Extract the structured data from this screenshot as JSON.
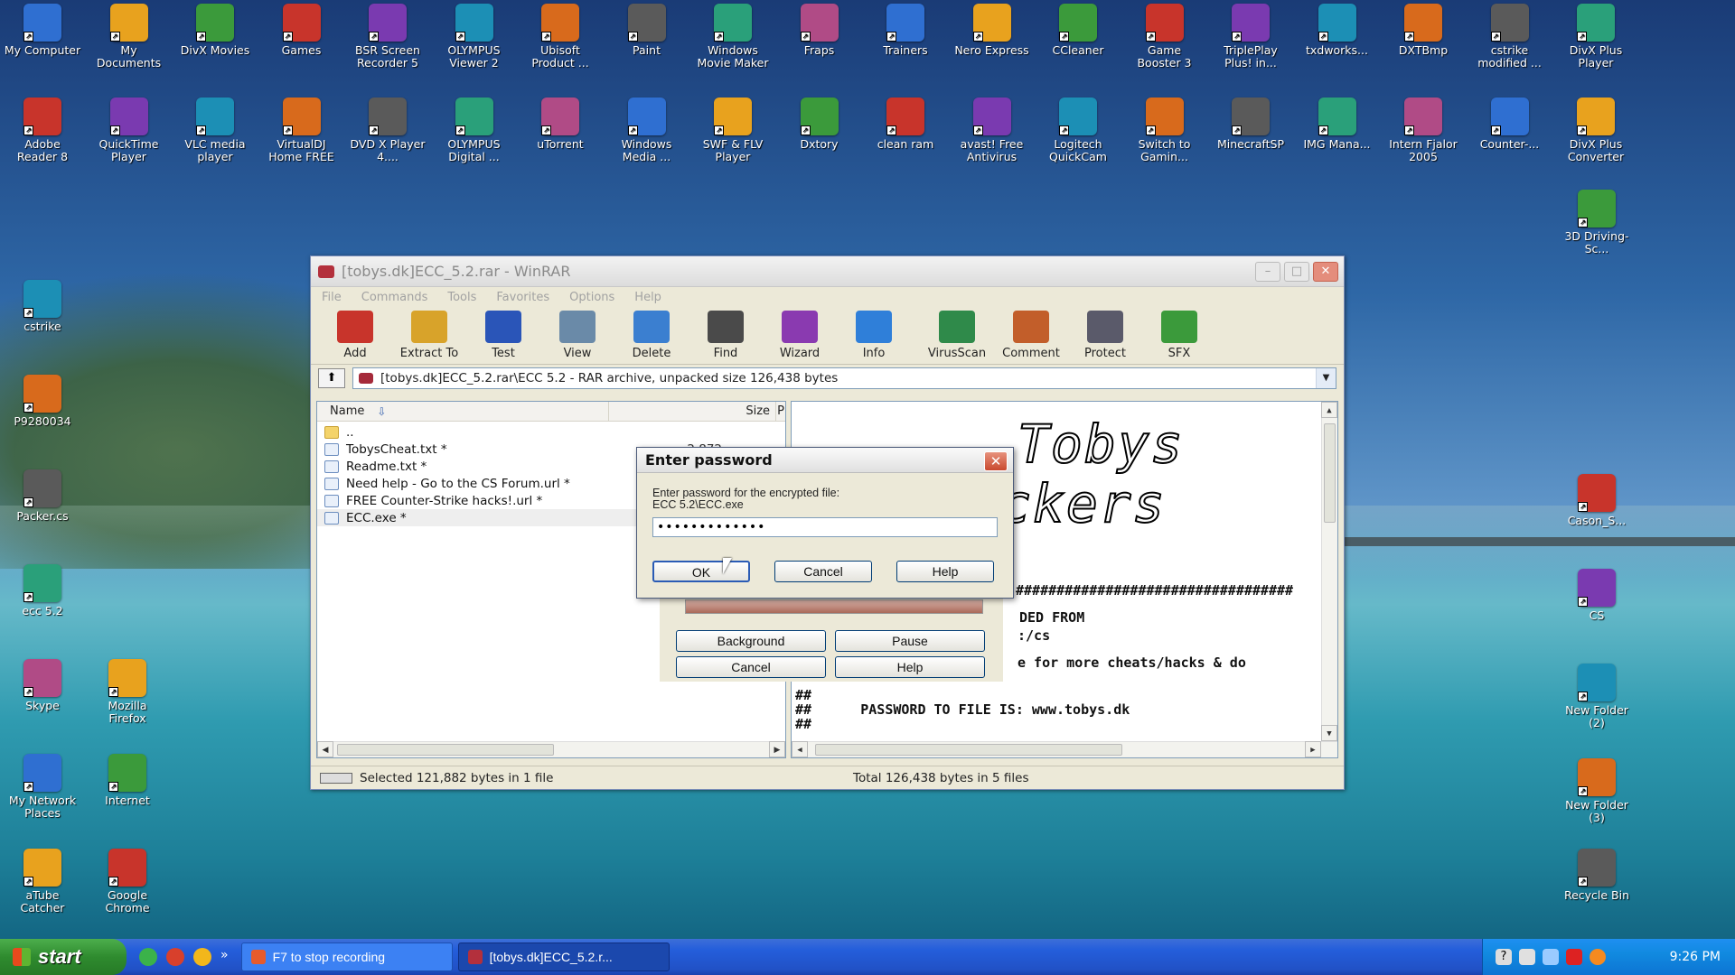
{
  "desktop": {
    "row1": [
      "My Computer",
      "My Documents",
      "DivX Movies",
      "Games",
      "BSR Screen Recorder 5",
      "OLYMPUS Viewer 2",
      "Ubisoft Product ...",
      "Paint",
      "Windows Movie Maker",
      "Fraps",
      "Trainers",
      "Nero Express",
      "CCleaner",
      "Game Booster 3",
      "TriplePlay Plus! in...",
      "txdworks...",
      "DXTBmp",
      "cstrike modified ...",
      "DivX Plus Player"
    ],
    "row2": [
      "Adobe Reader 8",
      "QuickTime Player",
      "VLC media player",
      "VirtualDJ Home FREE",
      "DVD X Player 4....",
      "OLYMPUS Digital ...",
      "uTorrent",
      "Windows Media ...",
      "SWF & FLV Player",
      "Dxtory",
      "clean ram",
      "avast! Free Antivirus",
      "Logitech QuickCam",
      "Switch to Gamin...",
      "MinecraftSP",
      "IMG Mana...",
      "Intern Fjalor 2005",
      "Counter-...",
      "DivX Plus Converter"
    ],
    "left_col": [
      "cstrike",
      "P9280034",
      "Packer.cs",
      "ecc 5.2",
      "Skype",
      "My Network Places",
      "aTube Catcher"
    ],
    "second_col": [
      "Mozilla Firefox",
      "Internet",
      "Google Chrome"
    ],
    "right_col": [
      "3D Driving-Sc...",
      "Cason_S...",
      "CS",
      "New Folder (2)",
      "New Folder (3)",
      "Recycle Bin"
    ]
  },
  "winrar": {
    "title": "[tobys.dk]ECC_5.2.rar - WinRAR",
    "menu": [
      "File",
      "Commands",
      "Tools",
      "Favorites",
      "Options",
      "Help"
    ],
    "toolbar": [
      "Add",
      "Extract To",
      "Test",
      "View",
      "Delete",
      "Find",
      "Wizard",
      "Info",
      "VirusScan",
      "Comment",
      "Protect",
      "SFX"
    ],
    "address": "[tobys.dk]ECC_5.2.rar\\ECC 5.2 - RAR archive, unpacked size 126,438 bytes",
    "columns": {
      "name": "Name",
      "size": "Size"
    },
    "files": [
      {
        "name": "..",
        "size": ""
      },
      {
        "name": "TobysCheat.txt *",
        "size": "2,872"
      },
      {
        "name": "Readme.txt *",
        "size": ""
      },
      {
        "name": "Need help - Go to the CS Forum.url *",
        "size": ""
      },
      {
        "name": "FREE Counter-Strike hacks!.url *",
        "size": ""
      },
      {
        "name": "ECC.exe *",
        "size": ""
      }
    ],
    "preview": {
      "art_line1": "Tobys",
      "art_line2": "ckers",
      "hash_line": "##################################",
      "line_downloaded": "DED FROM",
      "line_cs": ":/cs",
      "line_cheats": "e for more cheats/hacks & do",
      "line_hash1": "##",
      "line_password": "##      PASSWORD TO FILE IS: www.tobys.dk",
      "line_hash2": "##"
    },
    "status_left": "Selected 121,882 bytes in 1 file",
    "status_right": "Total 126,438 bytes in 5 files"
  },
  "progress_dialog": {
    "progress": 1.0,
    "buttons": [
      "Background",
      "Pause",
      "Cancel",
      "Help"
    ]
  },
  "password_dialog": {
    "title": "Enter password",
    "label_line1": "Enter password for the encrypted file:",
    "label_line2": "ECC 5.2\\ECC.exe",
    "value": "•••••••••••••",
    "ok": "OK",
    "cancel": "Cancel",
    "help": "Help"
  },
  "taskbar": {
    "start": "start",
    "tasks": [
      "F7 to stop recording",
      "[tobys.dk]ECC_5.2.r..."
    ],
    "clock": "9:26 PM"
  },
  "colors": {
    "accent": "#245edb",
    "winrar_red": "#b3303c"
  }
}
